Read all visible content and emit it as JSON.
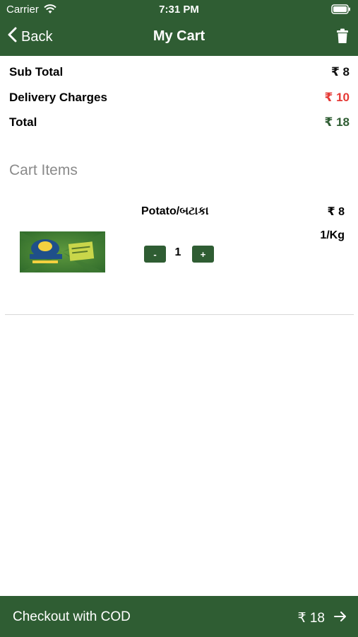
{
  "status_bar": {
    "carrier": "Carrier",
    "time": "7:31 PM"
  },
  "nav": {
    "back_label": "Back",
    "title": "My Cart"
  },
  "summary": {
    "subtotal_label": "Sub Total",
    "subtotal_value": "₹ 8",
    "delivery_label": "Delivery Charges",
    "delivery_value": "₹ 10",
    "total_label": "Total",
    "total_value": "₹ 18"
  },
  "cart_heading": "Cart Items",
  "items": [
    {
      "name": "Potato/બટાકા",
      "price": "₹ 8",
      "unit": "1/Kg",
      "quantity": "1",
      "minus_label": "-",
      "plus_label": "+"
    }
  ],
  "checkout": {
    "label": "Checkout with COD",
    "total": "₹ 18"
  },
  "colors": {
    "brand_green": "#2f5d33",
    "delivery_red": "#e53935",
    "heading_gray": "#8a8a8a"
  }
}
